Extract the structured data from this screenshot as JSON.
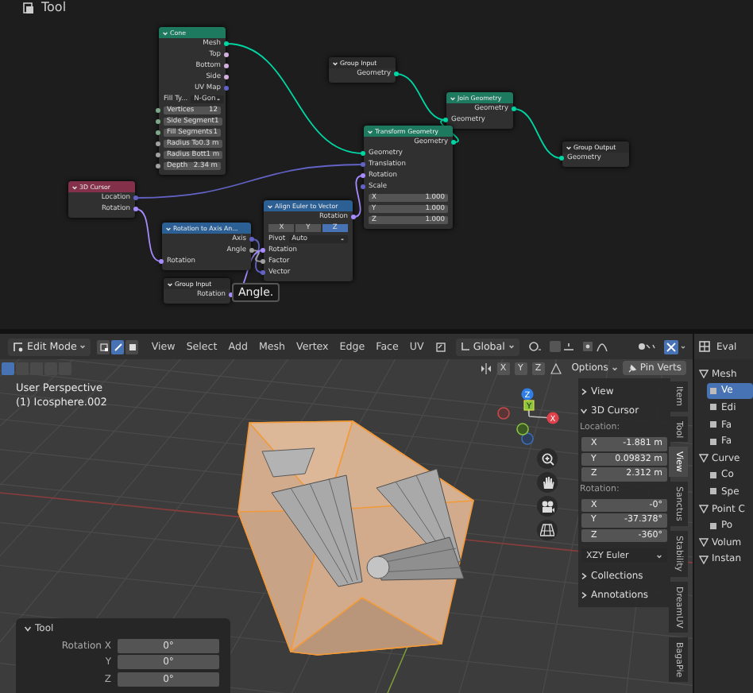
{
  "node_editor": {
    "tool_label": "Tool",
    "nodes": [
      {
        "title": "Cone",
        "color": "#1e7a5e",
        "rows": [
          {
            "kind": "output",
            "label": "Mesh",
            "color": "#00d6a3"
          },
          {
            "kind": "output",
            "label": "Top",
            "color": "#d4b0e0"
          },
          {
            "kind": "output",
            "label": "Bottom",
            "color": "#d4b0e0"
          },
          {
            "kind": "output",
            "label": "Side",
            "color": "#d4b0e0"
          },
          {
            "kind": "output",
            "label": "UV Map",
            "color": "#6363c7"
          },
          {
            "kind": "dropdown",
            "label": "Fill Ty...",
            "value": "N-Gon"
          },
          {
            "kind": "field",
            "label": "Vertices",
            "value": "12",
            "color": "#7fa88a"
          },
          {
            "kind": "field",
            "label": "Side Segment",
            "value": "1",
            "color": "#7fa88a"
          },
          {
            "kind": "field",
            "label": "Fill Segments",
            "value": "1",
            "color": "#7fa88a"
          },
          {
            "kind": "field",
            "label": "Radius To",
            "value": "0.3 m",
            "color": "#a1a1a1"
          },
          {
            "kind": "field",
            "label": "Radius Bott",
            "value": "1 m",
            "color": "#a1a1a1"
          },
          {
            "kind": "field",
            "label": "Depth",
            "value": "2.34 m",
            "color": "#a1a1a1"
          }
        ]
      },
      {
        "title": "Group Input",
        "color": "#2a2a2a",
        "rows": [
          {
            "kind": "output",
            "label": "Geometry",
            "color": "#00d6a3"
          }
        ]
      },
      {
        "title": "Join Geometry",
        "color": "#1e7a5e",
        "rows": [
          {
            "kind": "output",
            "label": "Geometry",
            "color": "#00d6a3"
          },
          {
            "kind": "input",
            "label": "Geometry",
            "color": "#00d6a3"
          }
        ]
      },
      {
        "title": "Transform Geometry",
        "color": "#1e7a5e",
        "rows": [
          {
            "kind": "output",
            "label": "Geometry",
            "color": "#00d6a3"
          },
          {
            "kind": "input",
            "label": "Geometry",
            "color": "#00d6a3"
          },
          {
            "kind": "input",
            "label": "Translation",
            "color": "#6363c7"
          },
          {
            "kind": "input",
            "label": "Rotation",
            "color": "#a68cff"
          },
          {
            "kind": "input",
            "label": "Scale",
            "color": "#6363c7"
          },
          {
            "kind": "field",
            "label": "X",
            "value": "1.000"
          },
          {
            "kind": "field",
            "label": "Y",
            "value": "1.000"
          },
          {
            "kind": "field",
            "label": "Z",
            "value": "1.000"
          }
        ]
      },
      {
        "title": "Group Output",
        "color": "#2a2a2a",
        "rows": [
          {
            "kind": "input",
            "label": "Geometry",
            "color": "#00d6a3"
          }
        ]
      },
      {
        "title": "3D Cursor",
        "color": "#83314a",
        "rows": [
          {
            "kind": "output",
            "label": "Location",
            "color": "#6363c7"
          },
          {
            "kind": "output",
            "label": "Rotation",
            "color": "#a68cff"
          }
        ]
      },
      {
        "title": "Rotation to Axis An...",
        "color": "#2c5f93",
        "rows": [
          {
            "kind": "output",
            "label": "Axis",
            "color": "#6363c7"
          },
          {
            "kind": "output",
            "label": "Angle",
            "color": "#a1a1a1"
          },
          {
            "kind": "input",
            "label": "Rotation",
            "color": "#a68cff"
          }
        ]
      },
      {
        "title": "Align Euler to Vector",
        "color": "#2c5f93",
        "rows": [
          {
            "kind": "output",
            "label": "Rotation",
            "color": "#a68cff"
          },
          {
            "kind": "toggles",
            "items": [
              {
                "label": "X",
                "selected": false
              },
              {
                "label": "Y",
                "selected": false
              },
              {
                "label": "Z",
                "selected": true
              }
            ]
          },
          {
            "kind": "dropdown",
            "label": "Pivot",
            "value": "Auto"
          },
          {
            "kind": "input",
            "label": "Rotation",
            "color": "#a68cff"
          },
          {
            "kind": "input",
            "label": "Factor",
            "color": "#a1a1a1"
          },
          {
            "kind": "input",
            "label": "Vector",
            "color": "#6363c7"
          }
        ]
      },
      {
        "title": "Group Input",
        "color": "#2a2a2a",
        "rows": [
          {
            "kind": "output",
            "label": "Rotation",
            "color": "#a68cff"
          }
        ]
      }
    ],
    "tooltip": "Angle."
  },
  "viewport_header": {
    "mode": "Edit Mode",
    "select_modes": [
      {
        "selected": false
      },
      {
        "selected": true
      },
      {
        "selected": false
      }
    ],
    "menus": [
      "View",
      "Select",
      "Add",
      "Mesh",
      "Vertex",
      "Edge",
      "Face",
      "UV"
    ],
    "orientation": "Global",
    "select_box_modes": [
      {
        "selected": true
      },
      {
        "selected": false
      },
      {
        "selected": false
      },
      {
        "selected": false
      },
      {
        "selected": false
      }
    ],
    "mirror_axes": [
      {
        "label": "X",
        "selected": false
      },
      {
        "label": "Y",
        "selected": false
      },
      {
        "label": "Z",
        "selected": false
      }
    ],
    "options": "Options",
    "pin_button": "Pin Verts"
  },
  "viewport": {
    "overlay_text": [
      "User Perspective",
      "(1) Icosphere.002"
    ],
    "gizmo_axes": [
      "Z",
      "Y",
      "X"
    ],
    "sidebar": {
      "sections": [
        {
          "title": "View",
          "expanded": false
        },
        {
          "title": "3D Cursor",
          "expanded": true,
          "groups": [
            {
              "label": "Location:",
              "fields": [
                {
                  "axis": "X",
                  "value": "-1.881 m"
                },
                {
                  "axis": "Y",
                  "value": "0.09832 m"
                },
                {
                  "axis": "Z",
                  "value": "2.312 m"
                }
              ]
            },
            {
              "label": "Rotation:",
              "fields": [
                {
                  "axis": "X",
                  "value": "-0°"
                },
                {
                  "axis": "Y",
                  "value": "-37.378°"
                },
                {
                  "axis": "Z",
                  "value": "-360°"
                }
              ]
            }
          ],
          "dropdown": "XZY Euler"
        },
        {
          "title": "Collections",
          "expanded": false
        },
        {
          "title": "Annotations",
          "expanded": false
        }
      ],
      "tabs": [
        {
          "label": "Item",
          "selected": false
        },
        {
          "label": "Tool",
          "selected": false
        },
        {
          "label": "View",
          "selected": true
        },
        {
          "label": "Sanctus",
          "selected": false
        },
        {
          "label": "Stability",
          "selected": false
        },
        {
          "label": "DreamUV",
          "selected": false
        },
        {
          "label": "BagaPie",
          "selected": false
        }
      ]
    },
    "tool_panel": {
      "title": "Tool",
      "fields": [
        {
          "label": "Rotation X",
          "value": "0°"
        },
        {
          "label": "Y",
          "value": "0°"
        },
        {
          "label": "Z",
          "value": "0°"
        }
      ]
    }
  },
  "properties": {
    "header": "Eval",
    "items": [
      {
        "label": "Mesh",
        "selected": false,
        "children": [
          {
            "label": "Ve",
            "selected": true
          },
          {
            "label": "Edi",
            "selected": false
          },
          {
            "label": "Fa",
            "selected": false
          },
          {
            "label": "Fa",
            "selected": false
          }
        ]
      },
      {
        "label": "Curve",
        "selected": false,
        "children": [
          {
            "label": "Co",
            "selected": false
          },
          {
            "label": "Spe",
            "selected": false
          }
        ]
      },
      {
        "label": "Point C",
        "selected": false,
        "children": [
          {
            "label": "Po",
            "selected": false
          }
        ]
      },
      {
        "label": "Volum",
        "selected": false
      },
      {
        "label": "Instan",
        "selected": false
      }
    ]
  }
}
